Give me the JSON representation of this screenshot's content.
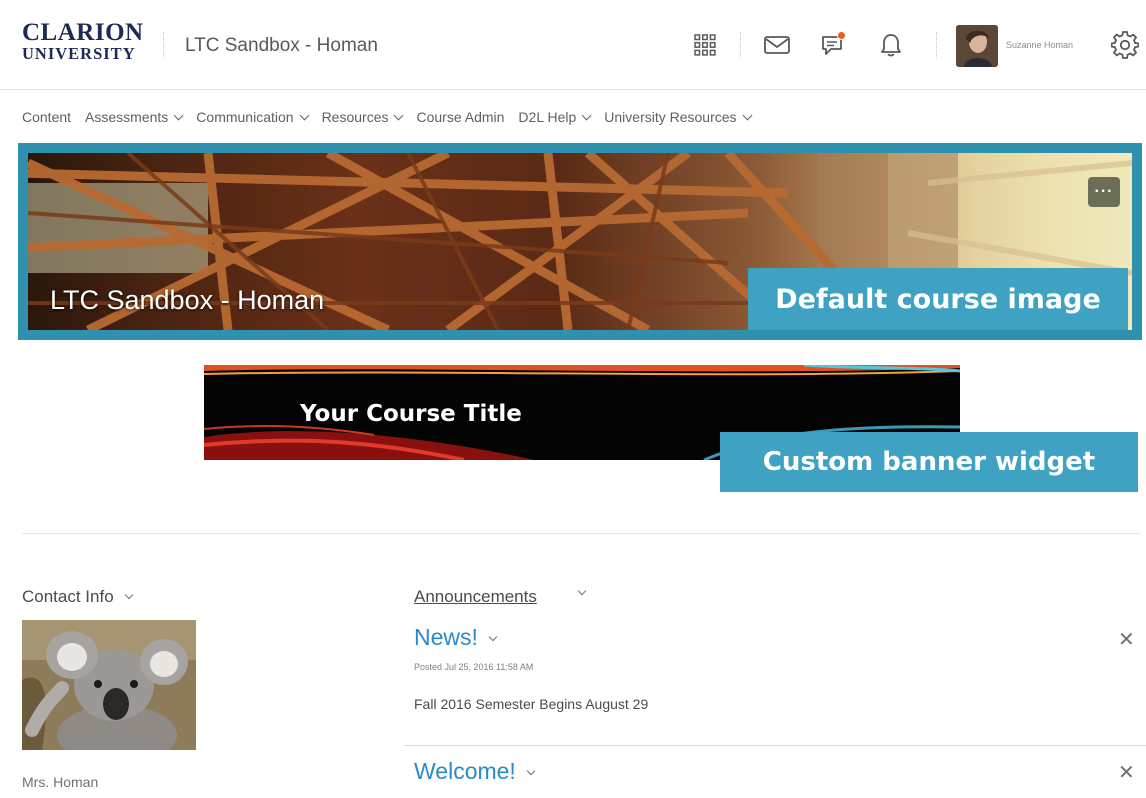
{
  "header": {
    "logo_line1": "CLARION",
    "logo_line2": "UNIVERSITY",
    "org_title": "LTC Sandbox - Homan",
    "user_name": "Suzanne Homan",
    "icons": [
      "waffle-icon",
      "mail-icon",
      "chat-icon",
      "bell-icon",
      "gear-icon"
    ],
    "alert_color": "#ef5b23"
  },
  "nav": {
    "items": [
      {
        "label": "Content",
        "dropdown": false
      },
      {
        "label": "Assessments",
        "dropdown": true
      },
      {
        "label": "Communication",
        "dropdown": true
      },
      {
        "label": "Resources",
        "dropdown": true
      },
      {
        "label": "Course Admin",
        "dropdown": false
      },
      {
        "label": "D2L Help",
        "dropdown": true
      },
      {
        "label": "University Resources",
        "dropdown": true
      }
    ]
  },
  "course_image": {
    "title": "LTC Sandbox - Homan",
    "more_label": "···",
    "callout": "Default course image",
    "frame_color": "#2f91ae"
  },
  "banner": {
    "title": "Your Course Title",
    "callout": "Custom banner widget",
    "callout_color": "#3fa2c3"
  },
  "contact": {
    "widget_title": "Contact Info",
    "name": "Mrs. Homan"
  },
  "announcements": {
    "widget_title": "Announcements",
    "items": [
      {
        "title": "News!",
        "posted": "Posted Jul 25, 2016 11:58 AM",
        "body": "Fall 2016 Semester Begins August 29",
        "dismiss": "✕"
      },
      {
        "title": "Welcome!",
        "dismiss": "✕"
      }
    ],
    "link_color": "#2a8bc9"
  }
}
